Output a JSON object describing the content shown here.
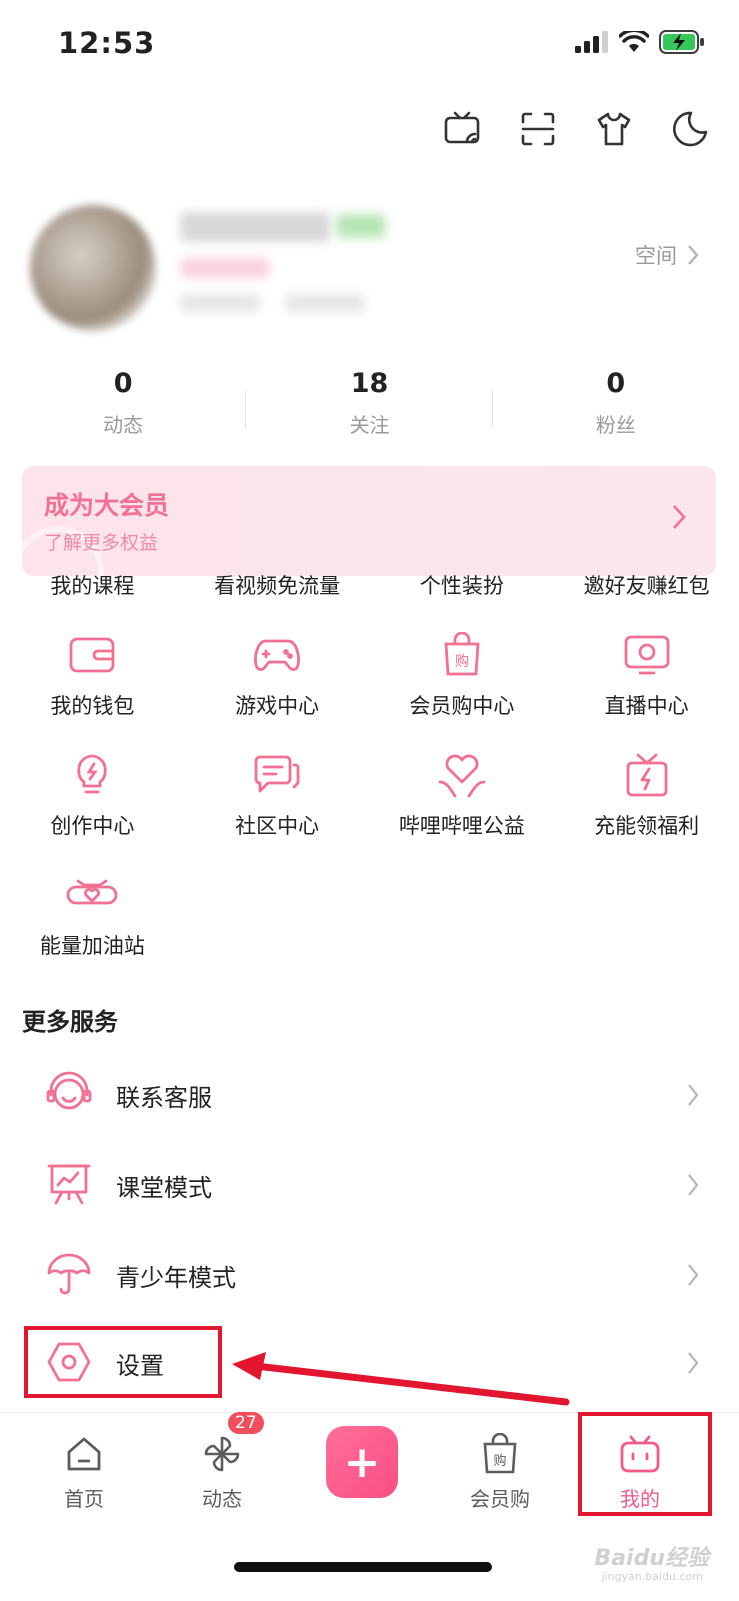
{
  "status": {
    "time": "12:53"
  },
  "profile": {
    "space_label": "空间"
  },
  "stats": [
    {
      "num": "0",
      "label": "动态"
    },
    {
      "num": "18",
      "label": "关注"
    },
    {
      "num": "0",
      "label": "粉丝"
    }
  ],
  "vip": {
    "title": "成为大会员",
    "subtitle": "了解更多权益"
  },
  "grid_row0": [
    "我的课程",
    "看视频免流量",
    "个性装扮",
    "邀好友赚红包"
  ],
  "grid": [
    {
      "label": "我的钱包",
      "icon": "wallet-icon"
    },
    {
      "label": "游戏中心",
      "icon": "gamepad-icon"
    },
    {
      "label": "会员购中心",
      "icon": "shopping-bag-icon"
    },
    {
      "label": "直播中心",
      "icon": "tv-icon"
    },
    {
      "label": "创作中心",
      "icon": "lightbulb-icon"
    },
    {
      "label": "社区中心",
      "icon": "chat-icon"
    },
    {
      "label": "哔哩哔哩公益",
      "icon": "heart-hands-icon"
    },
    {
      "label": "充能领福利",
      "icon": "gift-bolt-icon"
    },
    {
      "label": "能量加油站",
      "icon": "energy-station-icon"
    }
  ],
  "more_services": {
    "title": "更多服务",
    "items": [
      {
        "label": "联系客服",
        "icon": "headset-icon"
      },
      {
        "label": "课堂模式",
        "icon": "presentation-icon"
      },
      {
        "label": "青少年模式",
        "icon": "umbrella-icon"
      },
      {
        "label": "设置",
        "icon": "settings-hex-icon"
      }
    ]
  },
  "tabs": [
    {
      "label": "首页",
      "icon": "home-icon"
    },
    {
      "label": "动态",
      "icon": "pinwheel-icon",
      "badge": "27"
    },
    {
      "label": "会员购",
      "icon": "shopping-bag-icon"
    },
    {
      "label": "我的",
      "icon": "tv-mascot-icon"
    }
  ],
  "colors": {
    "accent": "#f17094",
    "highlight_box": "#e3162f",
    "tab_active": "#f15b8a"
  },
  "watermark": {
    "main": "Baidu经验",
    "sub": "jingyan.baidu.com"
  }
}
